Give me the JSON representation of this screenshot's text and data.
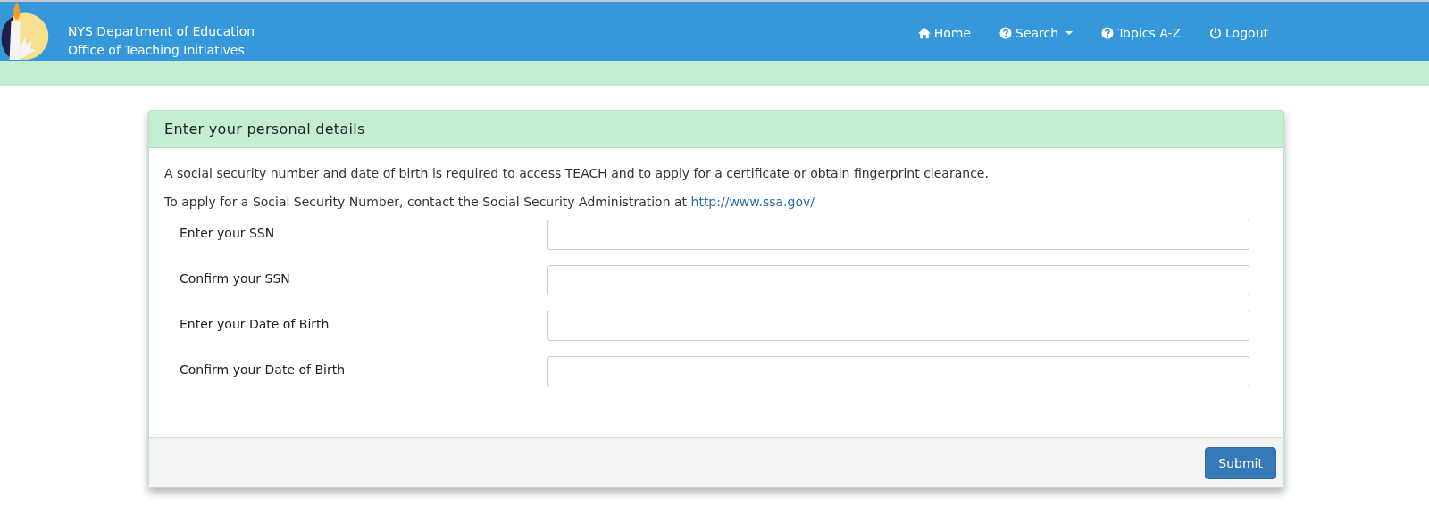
{
  "header": {
    "title_lines": [
      "NYS Department of Education",
      "Office of Teaching Initiatives"
    ],
    "nav": [
      {
        "label": "Home",
        "kind": "home",
        "dropdown": false
      },
      {
        "label": "Search",
        "kind": "help",
        "dropdown": true
      },
      {
        "label": "Topics A-Z",
        "kind": "help",
        "dropdown": false
      },
      {
        "label": "Logout",
        "kind": "power",
        "dropdown": false
      }
    ]
  },
  "panel": {
    "heading": "Enter your personal details",
    "intro": "A social security number and date of birth is required to access TEACH and to apply for a certificate or obtain fingerprint clearance.",
    "ssa_text": "To apply for a Social Security Number, contact the Social Security Administration at",
    "ssa_link": "http://www.ssa.gov/",
    "fields": [
      {
        "label": "Enter your SSN"
      },
      {
        "label": "Confirm your SSN"
      },
      {
        "label": "Enter your Date of Birth"
      },
      {
        "label": "Confirm your Date of Birth"
      }
    ],
    "submit": "Submit"
  }
}
